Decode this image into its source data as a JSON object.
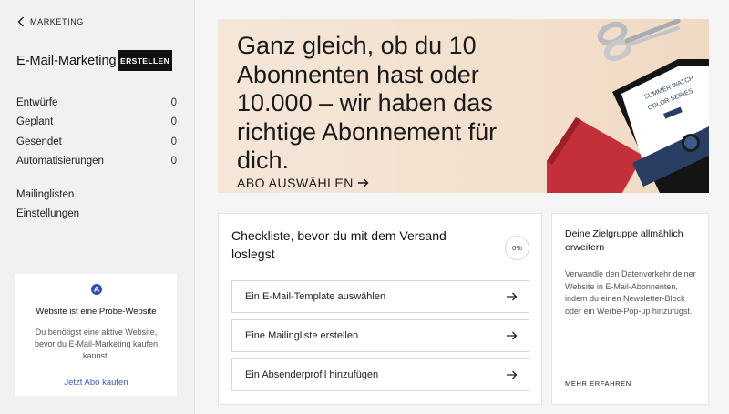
{
  "sidebar": {
    "back_label": "MARKETING",
    "app_title": "E-Mail-Marketing",
    "create_label": "ERSTELLEN",
    "counts": [
      {
        "label": "Entwürfe",
        "count": "0"
      },
      {
        "label": "Geplant",
        "count": "0"
      },
      {
        "label": "Gesendet",
        "count": "0"
      },
      {
        "label": "Automatisierungen",
        "count": "0"
      }
    ],
    "links": [
      "Mailinglisten",
      "Einstellungen"
    ],
    "notice": {
      "title": "Website ist eine Probe-Website",
      "text": "Du benötigst eine aktive Website, bevor du E-Mail-Marketing kaufen kannst.",
      "link": "Jetzt Abo kaufen"
    }
  },
  "hero": {
    "headline": "Ganz gleich, ob du 10 Abonnenten hast oder 10.000 – wir haben das richtige Abonnement für dich.",
    "cta": "ABO AUSWÄHLEN",
    "tablet_text_1": "SUMMER WATCH",
    "tablet_text_2": "COLOR SERIES",
    "bg_color": "#f3e0cd"
  },
  "checklist": {
    "title": "Checkliste, bevor du mit dem Versand loslegst",
    "progress": "0%",
    "tasks": [
      "Ein E-Mail-Template auswählen",
      "Eine Mailingliste erstellen",
      "Ein Absenderprofil hinzufügen"
    ]
  },
  "side_card": {
    "title": "Deine Zielgruppe allmählich erweitern",
    "text": "Verwandle den Datenverkehr deiner Website in E-Mail-Abonnenten, indem du einen Newsletter-Block oder ein Werbe-Pop-up hinzufügst.",
    "link": "MEHR ERFAHREN"
  },
  "colors": {
    "accent": "#111111",
    "link": "#3a57c8",
    "notice_icon": "#2f4fb3"
  }
}
